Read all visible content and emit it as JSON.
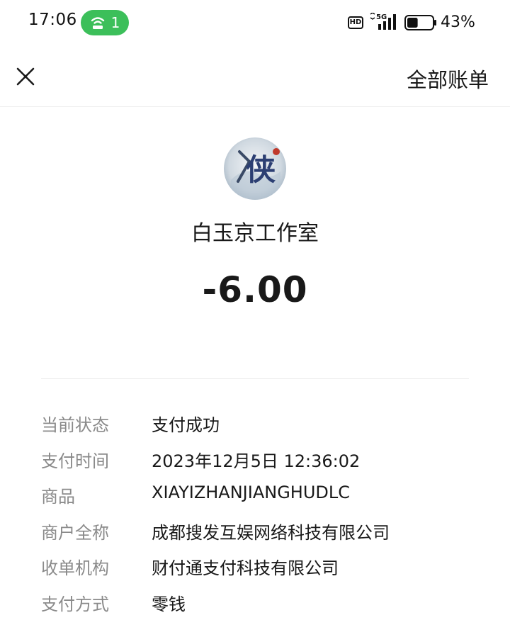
{
  "status_bar": {
    "time": "17:06",
    "hotspot_count": "1",
    "hd_label": "HD",
    "network_label": "5G",
    "battery_percent": "43%",
    "battery_level": 0.43,
    "pill_color": "#3cbf5a"
  },
  "nav": {
    "close_icon": "close-icon",
    "all_bills_label": "全部账单"
  },
  "merchant": {
    "avatar_icon": "game-logo-avatar",
    "avatar_glyph": "侠",
    "name": "白玉京工作室"
  },
  "amount": "-6.00",
  "details": [
    {
      "label": "当前状态",
      "value": "支付成功"
    },
    {
      "label": "支付时间",
      "value": "2023年12月5日 12:36:02"
    },
    {
      "label": "商品",
      "value": "XIAYIZHANJIANGHUDLC"
    },
    {
      "label": "商户全称",
      "value": "成都搜发互娱网络科技有限公司"
    },
    {
      "label": "收单机构",
      "value": "财付通支付科技有限公司"
    },
    {
      "label": "支付方式",
      "value": "零钱"
    }
  ]
}
